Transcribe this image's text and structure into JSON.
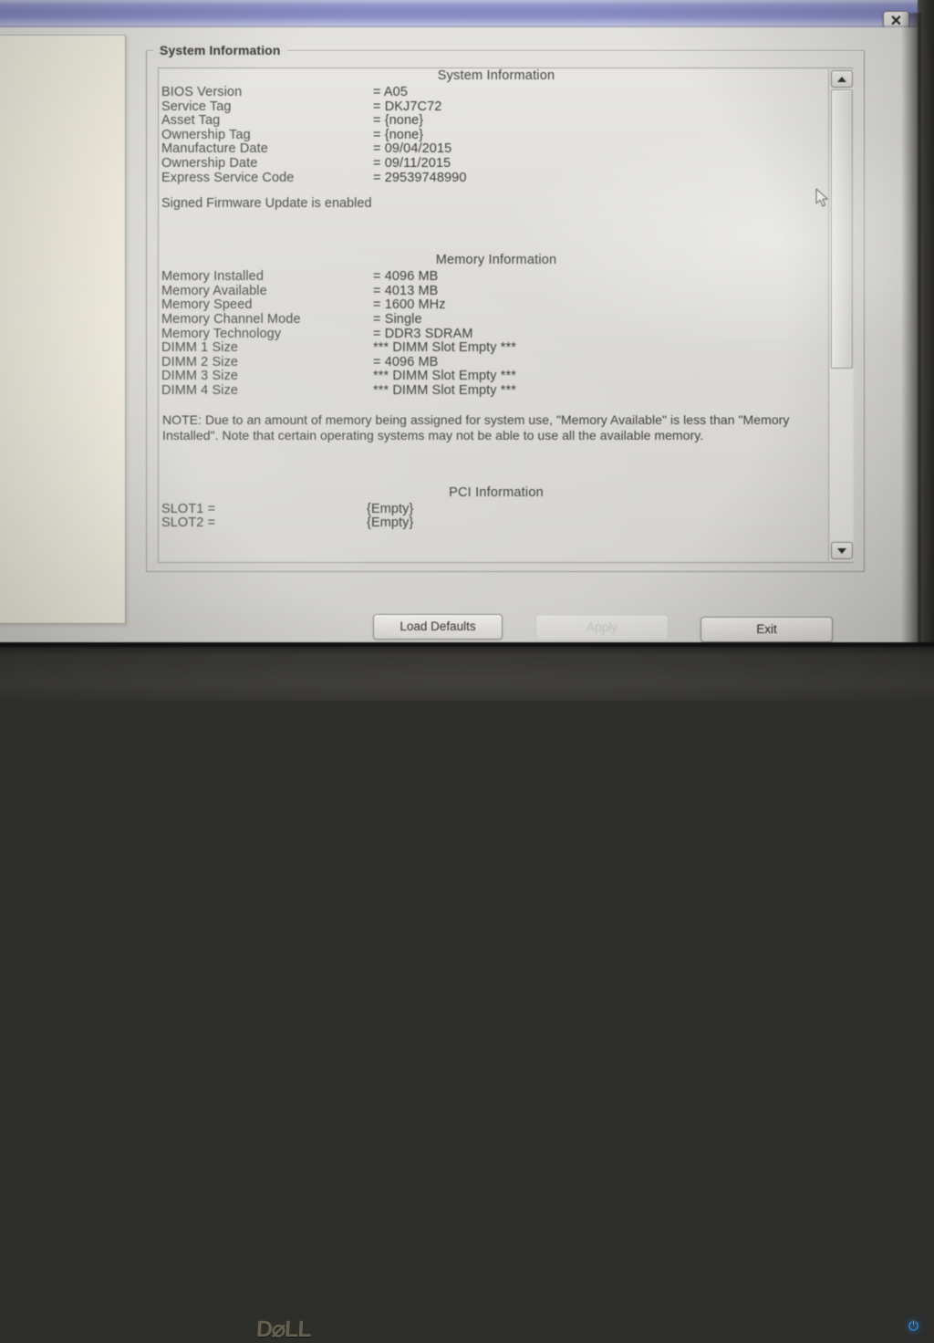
{
  "window": {
    "title_bar_color": "#8489c6",
    "close_icon": "✕"
  },
  "groupbox": {
    "legend": "System Information"
  },
  "sections": [
    {
      "heading": "System Information",
      "rows": [
        {
          "key": "BIOS Version",
          "value": "= A05"
        },
        {
          "key": "Service Tag",
          "value": "= DKJ7C72"
        },
        {
          "key": "Asset Tag",
          "value": "= {none}"
        },
        {
          "key": "Ownership Tag",
          "value": "= {none}"
        },
        {
          "key": "Manufacture Date",
          "value": "= 09/04/2015"
        },
        {
          "key": "Ownership Date",
          "value": "= 09/11/2015"
        },
        {
          "key": "Express Service Code",
          "value": "= 29539748990"
        }
      ],
      "footer_text": "Signed Firmware Update is enabled"
    },
    {
      "heading": "Memory Information",
      "rows": [
        {
          "key": "Memory Installed",
          "value": "= 4096 MB"
        },
        {
          "key": "Memory Available",
          "value": "= 4013 MB"
        },
        {
          "key": "Memory Speed",
          "value": "= 1600 MHz"
        },
        {
          "key": "Memory Channel Mode",
          "value": "= Single"
        },
        {
          "key": "Memory Technology",
          "value": "= DDR3 SDRAM"
        },
        {
          "key": "DIMM 1 Size",
          "value": "*** DIMM Slot Empty ***"
        },
        {
          "key": "DIMM 2 Size",
          "value": "= 4096 MB"
        },
        {
          "key": "DIMM 3 Size",
          "value": "*** DIMM Slot Empty ***"
        },
        {
          "key": "DIMM 4 Size",
          "value": "*** DIMM Slot Empty ***"
        }
      ],
      "note": "NOTE: Due to an amount of memory being assigned for system use, \"Memory Available\" is less than \"Memory Installed\". Note that certain operating systems may not be able to use all the available memory."
    },
    {
      "heading": "PCI Information",
      "rows": [
        {
          "key": "SLOT1 =",
          "value": "{Empty}"
        },
        {
          "key": "SLOT2 =",
          "value": "{Empty}"
        }
      ]
    }
  ],
  "scrollbar": {
    "up_arrow": "▲",
    "down_arrow": "▼"
  },
  "buttons": {
    "load_defaults": "Load Defaults",
    "apply": "Apply",
    "exit": "Exit"
  },
  "monitor": {
    "brand_logo": "D⌀LL",
    "power_led": "⏻"
  }
}
